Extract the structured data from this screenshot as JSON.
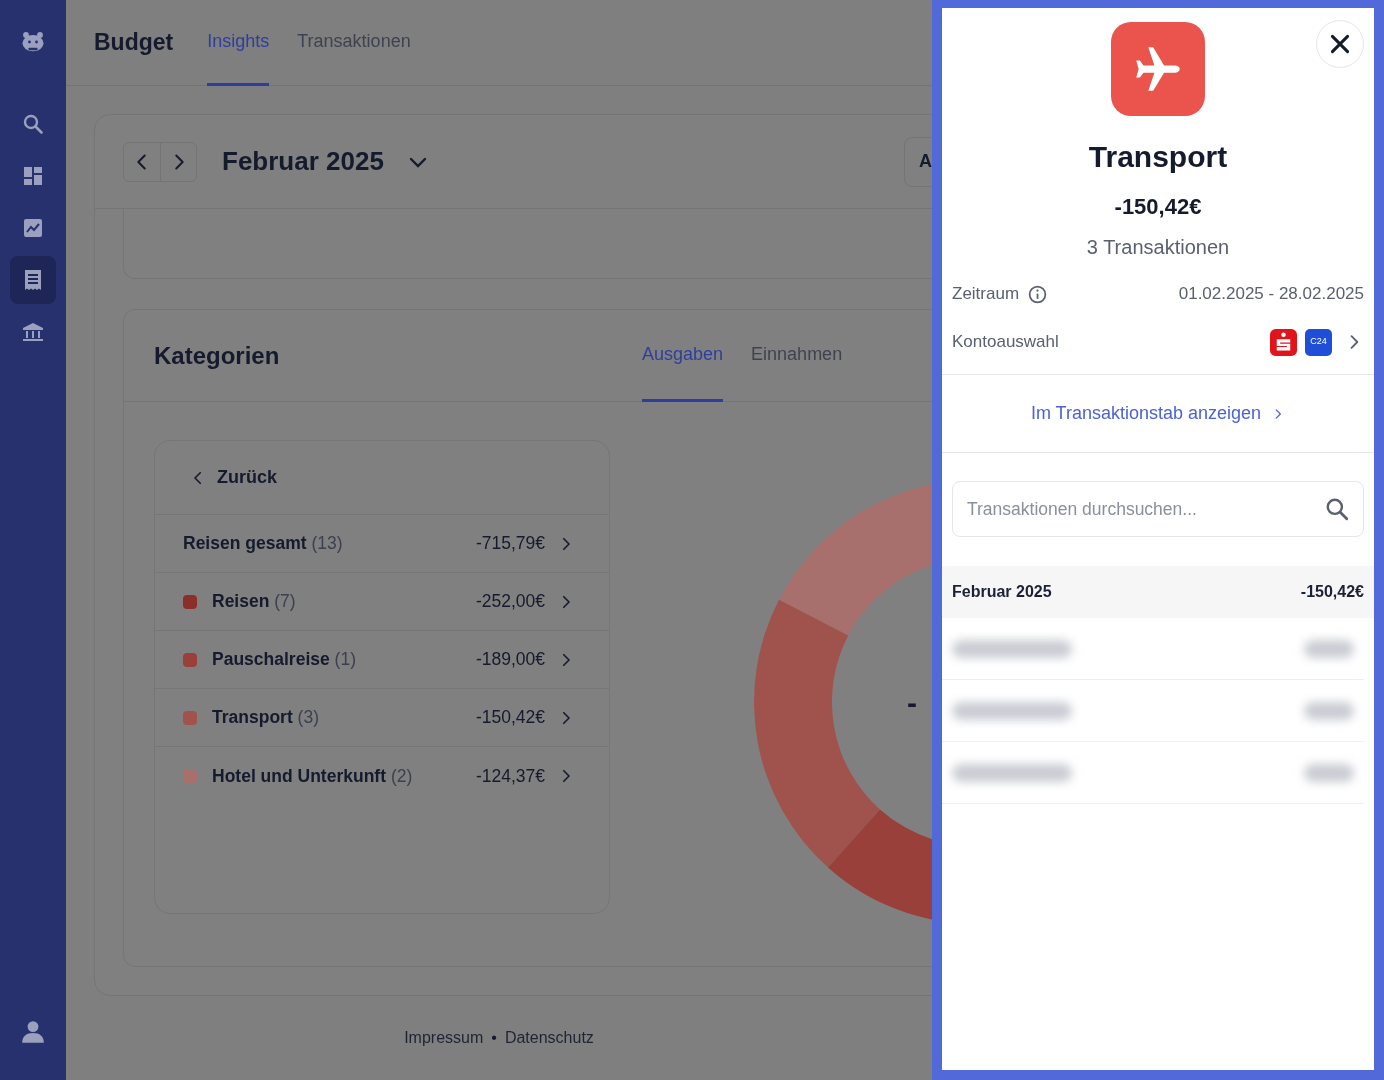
{
  "sidebar": {
    "items": [
      {
        "selected": false
      },
      {
        "selected": false
      },
      {
        "selected": false
      },
      {
        "selected": true
      },
      {
        "selected": false
      }
    ]
  },
  "header": {
    "title": "Budget",
    "tabs": [
      {
        "label": "Insights",
        "selected": true
      },
      {
        "label": "Transaktionen",
        "selected": false
      }
    ]
  },
  "period": {
    "label": "Februar 2025",
    "button_label": "A"
  },
  "categories": {
    "title": "Kategorien",
    "tabs": [
      {
        "label": "Ausgaben",
        "selected": true
      },
      {
        "label": "Einnahmen",
        "selected": false
      }
    ],
    "back_label": "Zurück",
    "total": {
      "name": "Reisen gesamt",
      "count": "(13)",
      "amount": "-715,79€"
    },
    "items": [
      {
        "name": "Reisen",
        "count": "(7)",
        "amount": "-252,00€",
        "color": "#8a2f2a"
      },
      {
        "name": "Pauschalreise",
        "count": "(1)",
        "amount": "-189,00€",
        "color": "#984039"
      },
      {
        "name": "Transport",
        "count": "(3)",
        "amount": "-150,42€",
        "color": "#a0534d"
      },
      {
        "name": "Hotel und Unterkunft",
        "count": "(2)",
        "amount": "-124,37€",
        "color": "#a8706c"
      }
    ],
    "chart_center": "-"
  },
  "footer": {
    "links": [
      "Impressum",
      "Datenschutz"
    ],
    "separator": "•"
  },
  "detail": {
    "title": "Transport",
    "amount": "-150,42€",
    "count": "3 Transaktionen",
    "period_label": "Zeitraum",
    "period": "01.02.2025 - 28.02.2025",
    "account_label": "Kontoauswahl",
    "account_badge": "C24",
    "link": "Im Transaktionstab anzeigen",
    "search": {
      "placeholder": "Transaktionen durchsuchen..."
    },
    "group": {
      "label": "Februar 2025",
      "amount": "-150,42€"
    },
    "transactions": [
      {
        "kind": "blurred"
      },
      {
        "kind": "blurred"
      },
      {
        "kind": "blurred"
      }
    ]
  }
}
